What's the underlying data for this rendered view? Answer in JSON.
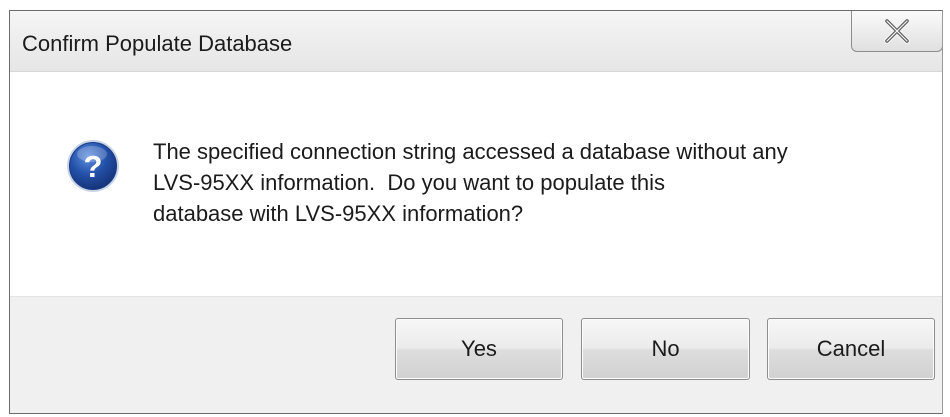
{
  "dialog": {
    "title": "Confirm Populate Database",
    "message_lines": [
      "The specified connection string accessed a database without any",
      "LVS-95XX information.  Do you want to populate this",
      "database with LVS-95XX information?"
    ],
    "icon": "question-icon",
    "close_icon": "close-icon"
  },
  "buttons": {
    "yes_label": "Yes",
    "no_label": "No",
    "cancel_label": "Cancel"
  },
  "colors": {
    "icon_blue": "#2350a8",
    "footer_bg": "#f0f0f0"
  }
}
